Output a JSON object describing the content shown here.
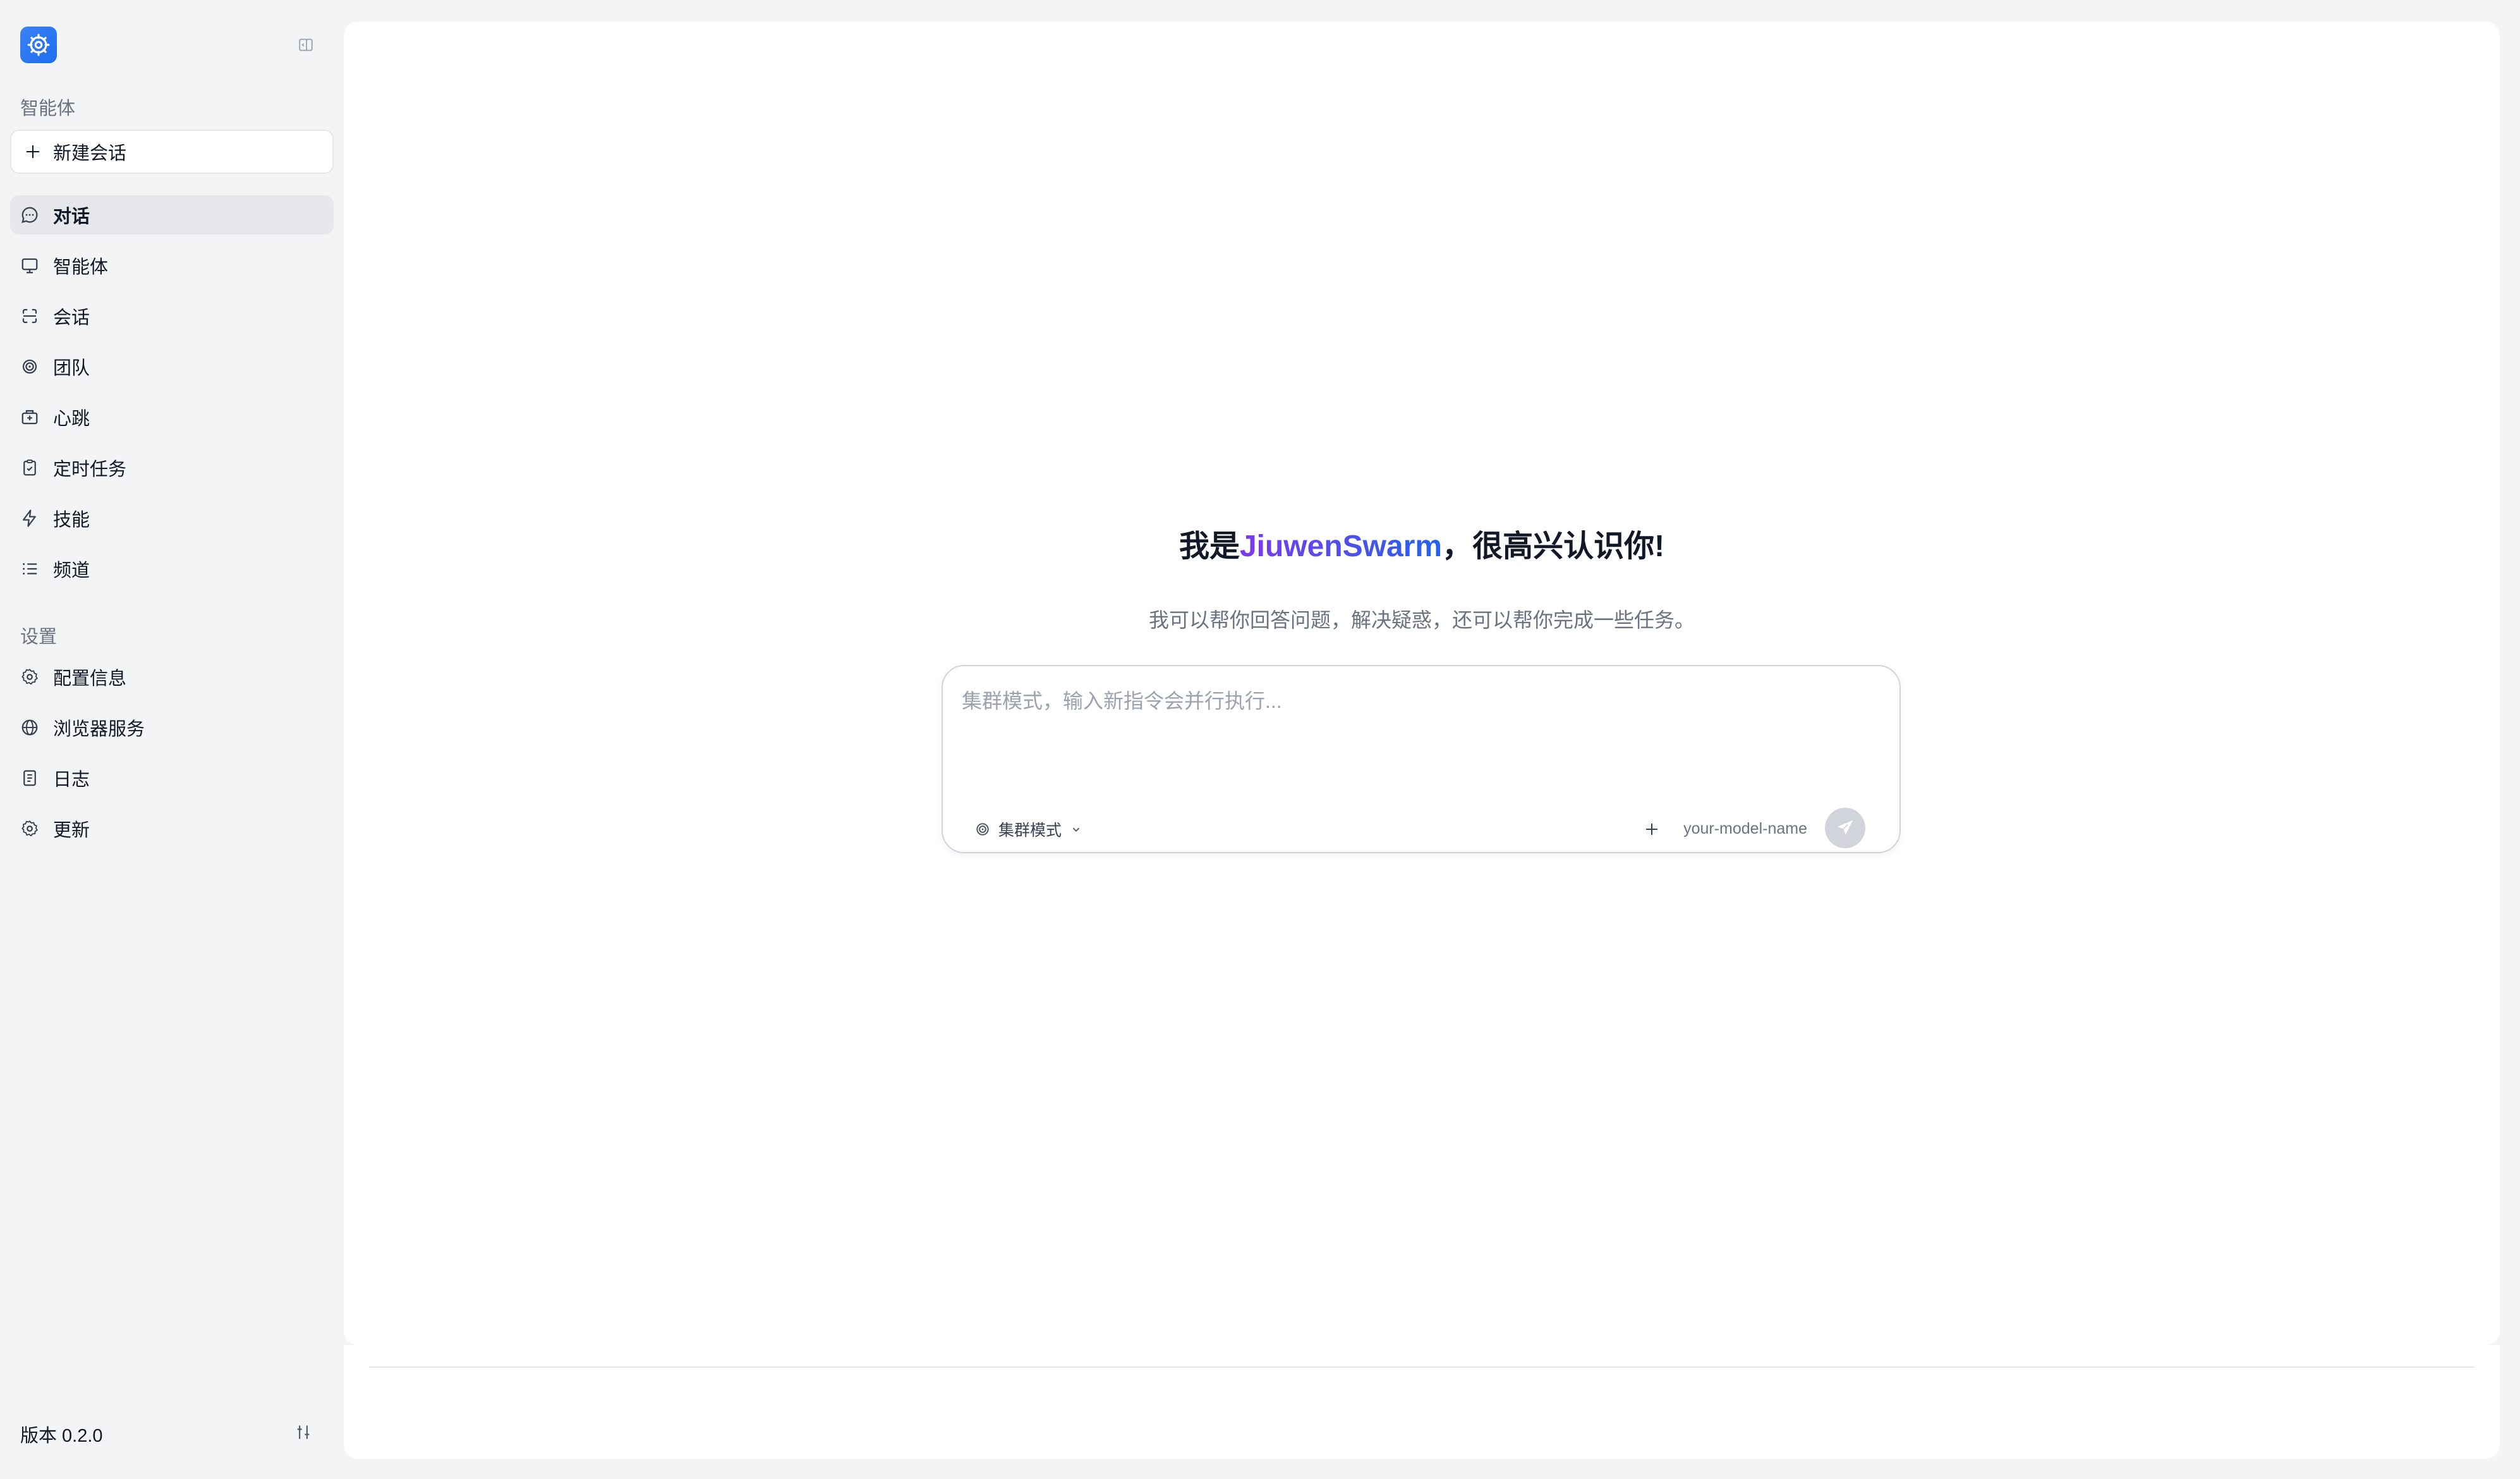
{
  "brand": {
    "logo_icon": "robot-gear-icon",
    "accent": "#1d6ef0"
  },
  "sidebar": {
    "section_agents_label": "智能体",
    "new_chat_label": "新建会话",
    "nav_items": [
      {
        "label": "对话",
        "icon": "chat-bubble-icon",
        "active": true
      },
      {
        "label": "智能体",
        "icon": "monitor-icon",
        "active": false
      },
      {
        "label": "会话",
        "icon": "session-icon",
        "active": false
      },
      {
        "label": "团队",
        "icon": "team-icon",
        "active": false
      },
      {
        "label": "心跳",
        "icon": "heartbeat-icon",
        "active": false
      },
      {
        "label": "定时任务",
        "icon": "clipboard-clock-icon",
        "active": false
      },
      {
        "label": "技能",
        "icon": "lightning-icon",
        "active": false
      },
      {
        "label": "频道",
        "icon": "list-icon",
        "active": false
      }
    ],
    "section_settings_label": "设置",
    "settings_items": [
      {
        "label": "配置信息",
        "icon": "gear-icon"
      },
      {
        "label": "浏览器服务",
        "icon": "globe-icon"
      },
      {
        "label": "日志",
        "icon": "log-icon"
      },
      {
        "label": "更新",
        "icon": "update-gear-icon"
      }
    ],
    "version_label": "版本 0.2.0"
  },
  "main": {
    "hero_prefix": "我是",
    "hero_brand": "JiuwenSwarm",
    "hero_suffix": "，很高兴认识你!",
    "hero_subtitle": "我可以帮你回答问题，解决疑惑，还可以帮你完成一些任务。",
    "composer": {
      "placeholder": "集群模式，输入新指令会并行执行...",
      "value": "",
      "mode_label": "集群模式",
      "model_name": "your-model-name"
    }
  }
}
